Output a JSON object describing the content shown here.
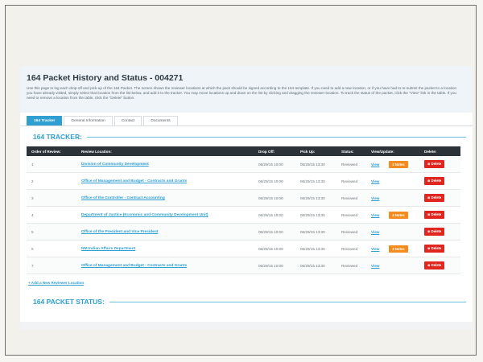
{
  "page": {
    "title": "164 Packet History and Status - 004271",
    "instructions": "Use this page to log each drop-off and pick-up of the 164 Packet. The screen shows the reviewer locations at which the pack should be signed according to the 164 template. If you need to add a new location, or if you have had to re-submit the packet to a location you have already visited, simply select that location from the list below, and add it to the tracker. You may move locations up and down on the list by clicking and dragging the reviewer location. To track the status of the packet, click the \"View\" link in the table. If you need to remove a location from the table, click the \"Delete\" button."
  },
  "tabs": [
    {
      "label": "164 Tracker"
    },
    {
      "label": "General Information"
    },
    {
      "label": "Contact"
    },
    {
      "label": "Documents"
    }
  ],
  "selected_tab": "164 Tracker",
  "tracker": {
    "heading": "164 TRACKER:",
    "columns": {
      "order": "Order of Review:",
      "location": "Review Location:",
      "dropoff": "Drop Off:",
      "pickup": "Pick Up:",
      "status": "Status:",
      "view": "View/Update:",
      "delete": "Delete:"
    },
    "rows": [
      {
        "order": "1",
        "location": "Division of Community Development",
        "dropoff": "06/29/15 10:00",
        "pickup": "06/29/15 13:30",
        "status": "Reviewed",
        "view": "View",
        "notes": "2 Notes",
        "delete": "⊗ Delete"
      },
      {
        "order": "2",
        "location": "Office of Management and Budget - Contracts and Grants",
        "dropoff": "06/29/15 10:00",
        "pickup": "06/29/15 13:30",
        "status": "Reviewed",
        "view": "View",
        "notes": "",
        "delete": "⊗ Delete"
      },
      {
        "order": "3",
        "location": "Office of the Controller - Contract Accounting",
        "dropoff": "06/29/15 10:00",
        "pickup": "06/29/15 13:30",
        "status": "Reviewed",
        "view": "View",
        "notes": "",
        "delete": "⊗ Delete"
      },
      {
        "order": "4",
        "location": "Department of Justice (Economic and Community Development Unit)",
        "dropoff": "06/29/15 10:00",
        "pickup": "06/29/15 13:30",
        "status": "Reviewed",
        "view": "View",
        "notes": "4 Notes",
        "delete": "⊗ Delete"
      },
      {
        "order": "5",
        "location": "Office of the President and Vice President",
        "dropoff": "06/29/15 10:00",
        "pickup": "06/29/15 13:30",
        "status": "Reviewed",
        "view": "View",
        "notes": "",
        "delete": "⊗ Delete"
      },
      {
        "order": "6",
        "location": "NM Indian Affairs Department",
        "dropoff": "06/29/15 10:00",
        "pickup": "06/29/15 13:30",
        "status": "Reviewed",
        "view": "View",
        "notes": "3 Notes",
        "delete": "⊗ Delete"
      },
      {
        "order": "7",
        "location": "Office of Management and Budget - Contracts and Grants",
        "dropoff": "06/29/15 10:00",
        "pickup": "06/29/15 13:30",
        "status": "Reviewed",
        "view": "View",
        "notes": "",
        "delete": "⊗ Delete"
      }
    ],
    "add_link": "+ Add a New Reviewer Location"
  },
  "status_section": {
    "heading": "164 PACKET STATUS:"
  },
  "colors": {
    "accent": "#2e9fd0",
    "header_dark": "#2b3338",
    "notes": "#f38b1f",
    "delete": "#e0261f"
  }
}
